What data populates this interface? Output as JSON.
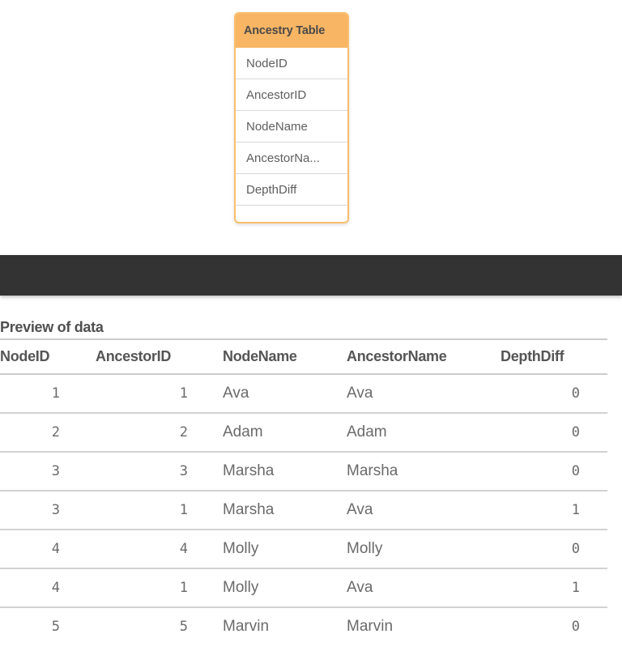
{
  "table_card": {
    "title": "Ancestry Table",
    "fields": [
      "NodeID",
      "AncestorID",
      "NodeName",
      "AncestorNa...",
      "DepthDiff"
    ],
    "accent_color": "#f8b564"
  },
  "preview": {
    "title": "Preview of data",
    "columns": [
      "NodeID",
      "AncestorID",
      "NodeName",
      "AncestorName",
      "DepthDiff"
    ],
    "rows": [
      [
        "1",
        "1",
        "Ava",
        "Ava",
        "0"
      ],
      [
        "2",
        "2",
        "Adam",
        "Adam",
        "0"
      ],
      [
        "3",
        "3",
        "Marsha",
        "Marsha",
        "0"
      ],
      [
        "3",
        "1",
        "Marsha",
        "Ava",
        "1"
      ],
      [
        "4",
        "4",
        "Molly",
        "Molly",
        "0"
      ],
      [
        "4",
        "1",
        "Molly",
        "Ava",
        "1"
      ],
      [
        "5",
        "5",
        "Marvin",
        "Marvin",
        "0"
      ]
    ]
  }
}
